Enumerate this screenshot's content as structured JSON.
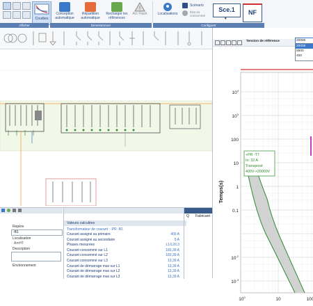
{
  "ribbon": {
    "courbes": "Courbes",
    "conception": "Conception automatique",
    "repartition": "Répartition automatique",
    "recharger": "Recharger les références",
    "arcflash": "Arc Flash",
    "localisations": "Localisations",
    "scenario": "Scénario",
    "etat": "État du consommé",
    "sce": "Sce.1",
    "nf": "NF",
    "groups": {
      "afficher": "Afficher",
      "dimensionner": "Dimensionner",
      "configurer": "Configurer"
    }
  },
  "tension": {
    "label": "Tension de référence",
    "value": "20000",
    "options": [
      "20000",
      "5500",
      "400"
    ]
  },
  "chart": {
    "ylabel": "Temps(s)",
    "yticks": [
      "10^4",
      "10^3",
      "100",
      "10",
      "1",
      "0.1",
      "10^-2",
      "10^-3"
    ],
    "xticks": [
      "10^0",
      "10",
      "100"
    ],
    "annotation": [
      "+PR -T7",
      "In: 32 A",
      "Transposé",
      "400V->20000V"
    ]
  },
  "left_panel": {
    "repere_label": "Repère",
    "repere_value": "-B1",
    "localisation_label": "Localisation",
    "localisation_value": "AmHT",
    "description_label": "Description",
    "environnement_label": "Environnement"
  },
  "values_panel": {
    "header": "Valeurs calculées",
    "subtitle": "Transformateur de courant : -PR -B1",
    "rows": [
      {
        "k": "Courant assigné au primaire",
        "v": "400 A"
      },
      {
        "k": "Courant assigné au secondaire",
        "v": "5 A"
      },
      {
        "k": "Phases mesurées",
        "v": "L1/L2/L3"
      },
      {
        "k": "Courant consommé sur L1",
        "v": "183,39 A"
      },
      {
        "k": "Courant consommé sur L2",
        "v": "183,39 A"
      },
      {
        "k": "Courant consommé sur L3",
        "v": "13,39 A"
      },
      {
        "k": "Courant de démarrage max sur L1",
        "v": "13,39 A"
      },
      {
        "k": "Courant de démarrage max sur L2",
        "v": "13,39 A"
      },
      {
        "k": "Courant de démarrage max sur L3",
        "v": "13,39 A"
      }
    ]
  },
  "right_bottom": {
    "q": "Q",
    "fabricant": "Fabricant"
  },
  "colors": {
    "accent": "#5b7fb3",
    "curve": "#2e8b2e",
    "red": "#d03030"
  }
}
